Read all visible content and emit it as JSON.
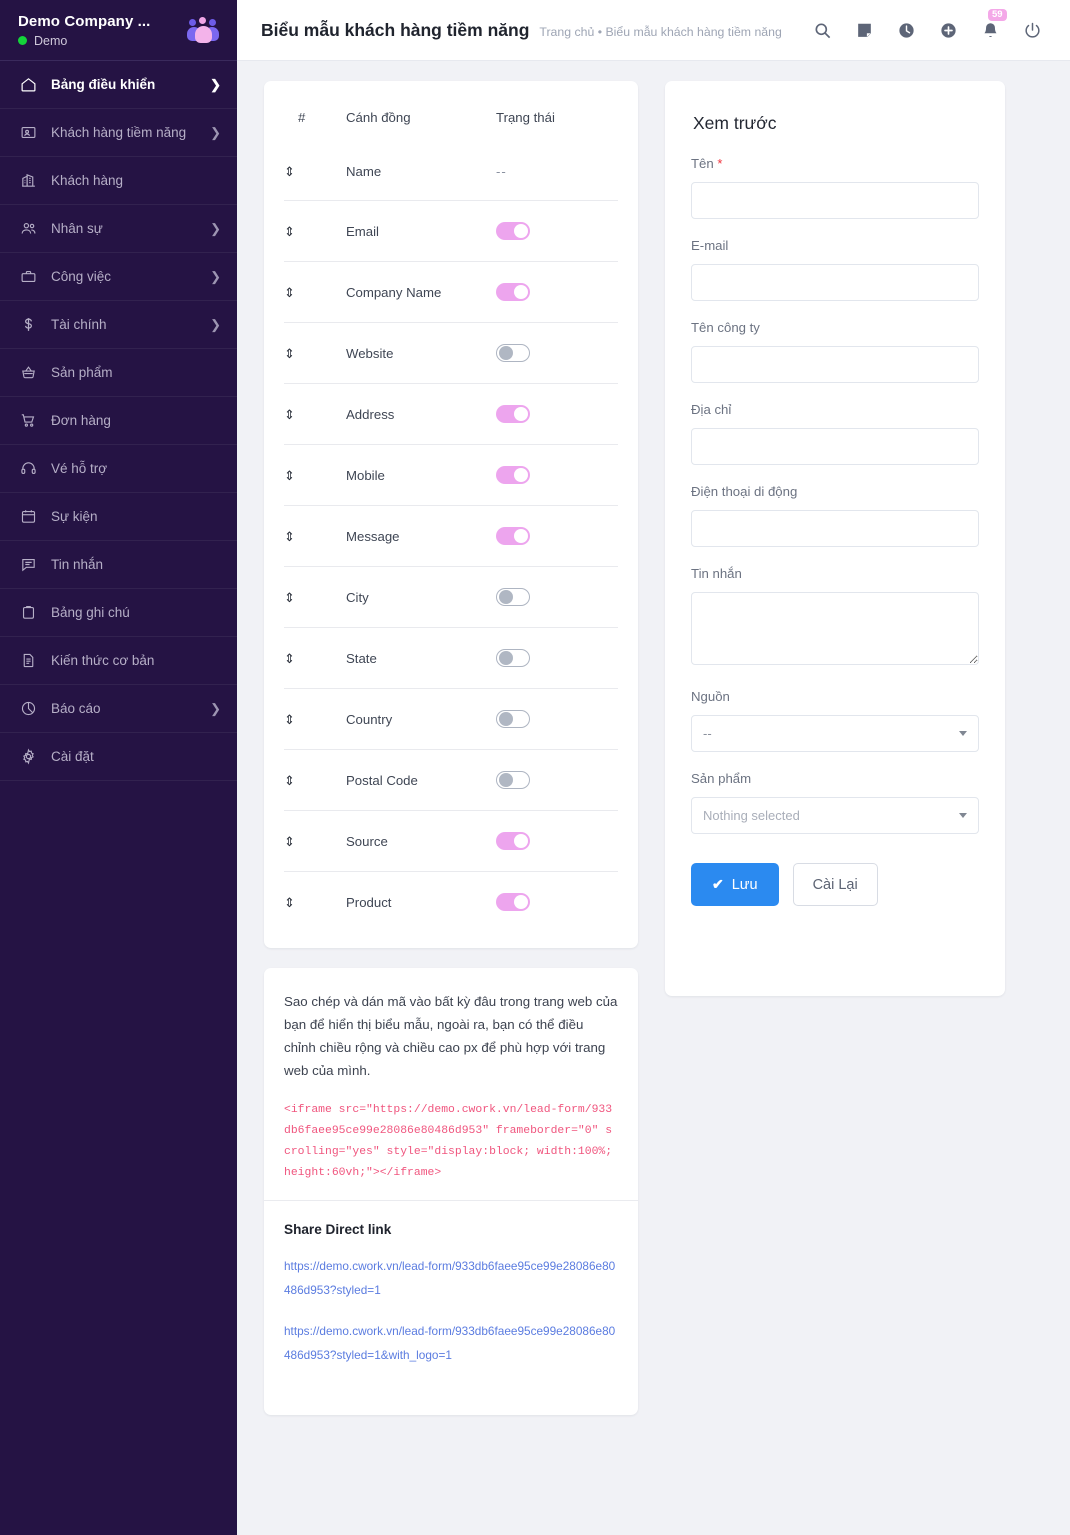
{
  "sidebar": {
    "brand": {
      "title": "Demo Company ...",
      "status": "Demo",
      "logo_icon": "people-group-icon"
    },
    "items": [
      {
        "label": "Bảng điều khiển",
        "icon": "home-icon",
        "active": true,
        "chevron": true
      },
      {
        "label": "Khách hàng tiềm năng",
        "icon": "id-card-icon",
        "active": false,
        "chevron": true
      },
      {
        "label": "Khách hàng",
        "icon": "building-icon",
        "active": false,
        "chevron": false
      },
      {
        "label": "Nhân sự",
        "icon": "users-icon",
        "active": false,
        "chevron": true
      },
      {
        "label": "Công việc",
        "icon": "briefcase-icon",
        "active": false,
        "chevron": true
      },
      {
        "label": "Tài chính",
        "icon": "dollar-icon",
        "active": false,
        "chevron": true
      },
      {
        "label": "Sản phẩm",
        "icon": "basket-icon",
        "active": false,
        "chevron": false
      },
      {
        "label": "Đơn hàng",
        "icon": "cart-icon",
        "active": false,
        "chevron": false
      },
      {
        "label": "Vé hỗ trợ",
        "icon": "headset-icon",
        "active": false,
        "chevron": false
      },
      {
        "label": "Sự kiện",
        "icon": "calendar-icon",
        "active": false,
        "chevron": false
      },
      {
        "label": "Tin nhắn",
        "icon": "chat-icon",
        "active": false,
        "chevron": false
      },
      {
        "label": "Bảng ghi chú",
        "icon": "clipboard-icon",
        "active": false,
        "chevron": false
      },
      {
        "label": "Kiến thức cơ bản",
        "icon": "document-icon",
        "active": false,
        "chevron": false
      },
      {
        "label": "Báo cáo",
        "icon": "pie-chart-icon",
        "active": false,
        "chevron": true
      },
      {
        "label": "Cài đặt",
        "icon": "gear-icon",
        "active": false,
        "chevron": false
      }
    ]
  },
  "topbar": {
    "title": "Biểu mẫu khách hàng tiềm năng",
    "breadcrumb": "Trang chủ • Biểu mẫu khách hàng tiềm năng",
    "icons": [
      {
        "name": "search-icon"
      },
      {
        "name": "note-icon"
      },
      {
        "name": "clock-icon"
      },
      {
        "name": "plus-circle-icon"
      },
      {
        "name": "bell-icon",
        "badge": "59"
      },
      {
        "name": "power-icon"
      }
    ]
  },
  "fields_table": {
    "headers": {
      "num": "#",
      "field": "Cánh đồng",
      "status": "Trạng thái"
    },
    "rows": [
      {
        "handle": "⇕",
        "field": "Name",
        "status": "none",
        "status_text": "--"
      },
      {
        "handle": "⇕",
        "field": "Email",
        "status": "on"
      },
      {
        "handle": "⇕",
        "field": "Company Name",
        "status": "on"
      },
      {
        "handle": "⇕",
        "field": "Website",
        "status": "off"
      },
      {
        "handle": "⇕",
        "field": "Address",
        "status": "on"
      },
      {
        "handle": "⇕",
        "field": "Mobile",
        "status": "on"
      },
      {
        "handle": "⇕",
        "field": "Message",
        "status": "on"
      },
      {
        "handle": "⇕",
        "field": "City",
        "status": "off"
      },
      {
        "handle": "⇕",
        "field": "State",
        "status": "off"
      },
      {
        "handle": "⇕",
        "field": "Country",
        "status": "off"
      },
      {
        "handle": "⇕",
        "field": "Postal Code",
        "status": "off"
      },
      {
        "handle": "⇕",
        "field": "Source",
        "status": "on"
      },
      {
        "handle": "⇕",
        "field": "Product",
        "status": "on"
      }
    ]
  },
  "embed": {
    "description": "Sao chép và dán mã vào bất kỳ đâu trong trang web của bạn để hiển thị biểu mẫu, ngoài ra, bạn có thể điều chỉnh chiều rộng và chiều cao px để phù hợp với trang web của mình.",
    "code": "<iframe src=\"https://demo.cwork.vn/lead-form/933db6faee95ce99e28086e80486d953\" frameborder=\"0\" scrolling=\"yes\" style=\"display:block; width:100%; height:60vh;\"></iframe>",
    "share_title": "Share Direct link",
    "links": [
      "https://demo.cwork.vn/lead-form/933db6faee95ce99e28086e80486d953?styled=1",
      "https://demo.cwork.vn/lead-form/933db6faee95ce99e28086e80486d953?styled=1&with_logo=1"
    ]
  },
  "preview": {
    "title": "Xem trước",
    "fields": [
      {
        "label": "Tên",
        "required": true,
        "type": "text",
        "value": ""
      },
      {
        "label": "E-mail",
        "required": false,
        "type": "text",
        "value": ""
      },
      {
        "label": "Tên công ty",
        "required": false,
        "type": "text",
        "value": ""
      },
      {
        "label": "Địa chỉ",
        "required": false,
        "type": "text",
        "value": ""
      },
      {
        "label": "Điện thoại di động",
        "required": false,
        "type": "text",
        "value": ""
      },
      {
        "label": "Tin nhắn",
        "required": false,
        "type": "textarea",
        "value": ""
      },
      {
        "label": "Nguồn",
        "required": false,
        "type": "select",
        "value": "--"
      },
      {
        "label": "Sản phẩm",
        "required": false,
        "type": "select",
        "value": "Nothing selected"
      }
    ],
    "save_label": "Lưu",
    "save_check": "✔",
    "reset_label": "Cài Lại"
  },
  "colors": {
    "sidebar_bg": "#251344",
    "accent_pink": "#eda5ee",
    "primary_blue": "#2b8af0",
    "link_blue": "#5b7ce0",
    "code_pink": "#f0557e",
    "online_green": "#14d43a",
    "required_red": "#f0323c"
  }
}
